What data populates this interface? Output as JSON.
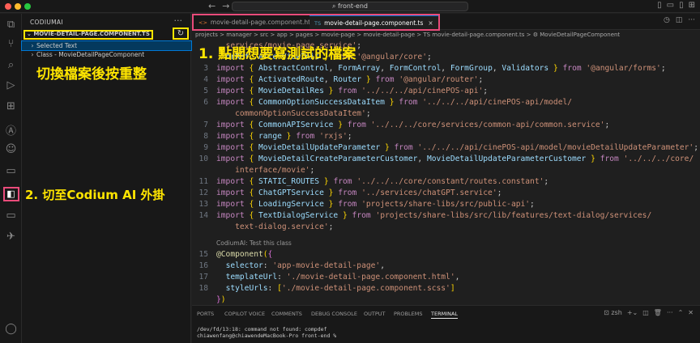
{
  "titlebar": {
    "search_text": "front-end",
    "nav_back": "←",
    "nav_forward": "→"
  },
  "sidebar": {
    "title": "CODIUMAI",
    "more": "···",
    "section_header": "MOVIE-DETAIL-PAGE.COMPONENT.TS",
    "items": [
      {
        "label": "Selected Text",
        "selected": true
      },
      {
        "label": "Class - MovieDetailPageComponent",
        "selected": false
      }
    ],
    "refresh_icon": "refresh-icon"
  },
  "annotations": {
    "switch_and_refresh": "切換檔案後按重整",
    "open_file": "1. 點開想要寫測試的檔案",
    "switch_to_codium": "2. 切至Codium AI 外掛"
  },
  "tabs": [
    {
      "label": "movie-detail-page.component.html",
      "icon": "<>",
      "active": false
    },
    {
      "label": "movie-detail-page.component.ts",
      "icon": "TS",
      "active": true,
      "close": "×"
    }
  ],
  "breadcrumbs": "projects > manager > src > app > pages > movie-page > movie-detail-page > TS movie-detail-page.component.ts > ⚙ MovieDetailPageComponent",
  "code": {
    "line_numbers": [
      "",
      "",
      "3",
      "4",
      "5",
      "6",
      "",
      "7",
      "8",
      "9",
      "10",
      "",
      "11",
      "12",
      "13",
      "14",
      "",
      "",
      "15",
      "16",
      "17",
      "18",
      ""
    ],
    "codelens": "CodiumAI: Test this class"
  },
  "panel": {
    "tabs": [
      "PORTS",
      "COPILOT VOICE",
      "COMMENTS",
      "DEBUG CONSOLE",
      "OUTPUT",
      "PROBLEMS",
      "TERMINAL"
    ],
    "active_tab": "TERMINAL",
    "shell": "zsh",
    "terminal_lines": [
      "/dev/fd/13:18: command not found: compdef",
      "chiawenfang@chiawendeMacBook-Pro front-end %"
    ]
  },
  "colors": {
    "annotation_yellow": "#ffe500",
    "annotation_pink": "#e94b7a",
    "accent": "#0078d4"
  }
}
